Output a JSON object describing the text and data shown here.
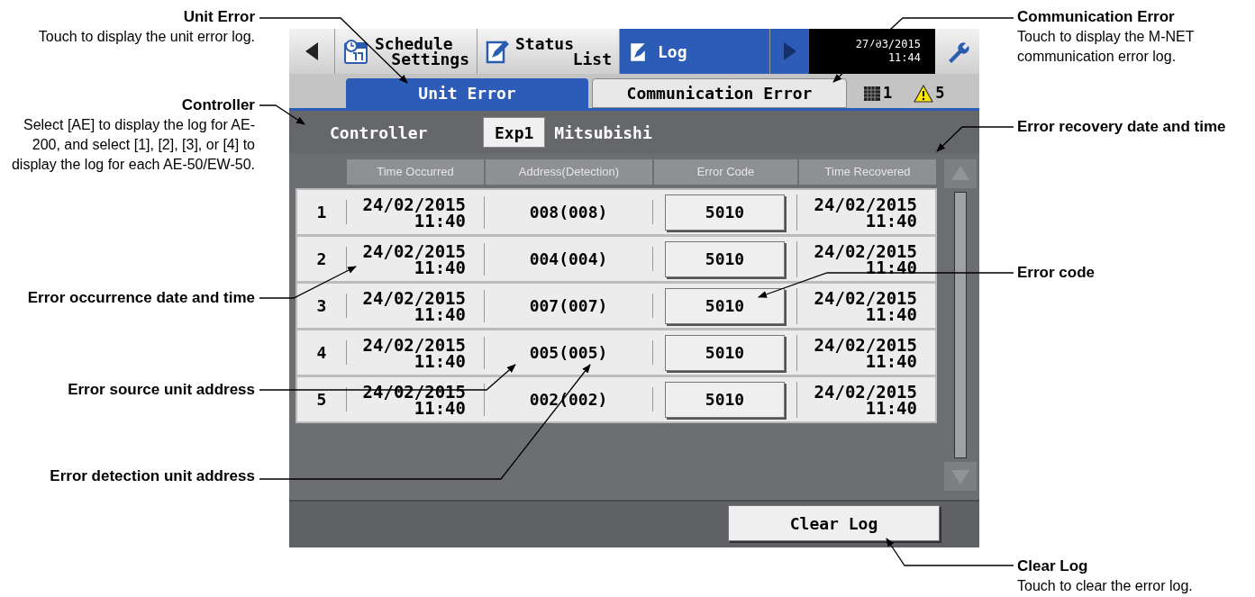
{
  "callouts_left": [
    {
      "title": "Unit Error",
      "text": "Touch to display the unit error log."
    },
    {
      "title": "Controller",
      "text": "Select [AE] to display the log for AE-200, and select [1], [2], [3], or [4] to display the log for each AE-50/EW-50."
    },
    {
      "title": "Error occurrence date and time"
    },
    {
      "title": "Error source unit address"
    },
    {
      "title": "Error detection unit address"
    }
  ],
  "callouts_right": [
    {
      "title": "Communication Error",
      "text": "Touch to display the M-NET communication error log."
    },
    {
      "title": "Error recovery date and time"
    },
    {
      "title": "Error code"
    },
    {
      "title": "Clear Log",
      "text": "Touch to clear the error log."
    }
  ],
  "screen": {
    "nav_back": {
      "disabled": false
    },
    "menu_tabs": [
      {
        "kind": "calendar",
        "lines": [
          "Schedule",
          "Settings"
        ],
        "selected": false
      },
      {
        "kind": "pencil",
        "lines": [
          "Status",
          "List"
        ],
        "selected": false
      },
      {
        "kind": "pencil",
        "lines": [
          "Log"
        ],
        "selected": true
      }
    ],
    "nav_forward": {
      "disabled": true
    },
    "clock": {
      "date": "27/03/2015",
      "time": "11:44"
    },
    "log_tabs": [
      {
        "label": "Unit Error",
        "selected": true
      },
      {
        "label": "Communication Error",
        "selected": false
      }
    ],
    "indicators": [
      {
        "kind": "grid",
        "count": "1"
      },
      {
        "kind": "warning",
        "count": "5"
      }
    ],
    "controller": {
      "label": "Controller",
      "button": "Exp1",
      "name": "Mitsubishi"
    },
    "table": {
      "columns": [
        "Time Occurred",
        "Address(Detection)",
        "Error Code",
        "Time Recovered"
      ],
      "rows": [
        {
          "number": "1",
          "occurred": [
            "24/02/2015",
            "11:40"
          ],
          "address": "008(008)",
          "code": "5010",
          "recovered": [
            "24/02/2015",
            "11:40"
          ]
        },
        {
          "number": "2",
          "occurred": [
            "24/02/2015",
            "11:40"
          ],
          "address": "004(004)",
          "code": "5010",
          "recovered": [
            "24/02/2015",
            "11:40"
          ]
        },
        {
          "number": "3",
          "occurred": [
            "24/02/2015",
            "11:40"
          ],
          "address": "007(007)",
          "code": "5010",
          "recovered": [
            "24/02/2015",
            "11:40"
          ]
        },
        {
          "number": "4",
          "occurred": [
            "24/02/2015",
            "11:40"
          ],
          "address": "005(005)",
          "code": "5010",
          "recovered": [
            "24/02/2015",
            "11:40"
          ]
        },
        {
          "number": "5",
          "occurred": [
            "24/02/2015",
            "11:40"
          ],
          "address": "002(002)",
          "code": "5010",
          "recovered": [
            "24/02/2015",
            "11:40"
          ]
        }
      ]
    },
    "clear_button": "Clear Log"
  }
}
